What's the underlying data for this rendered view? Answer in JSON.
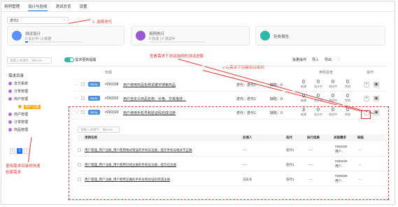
{
  "tabs": [
    "用例管理",
    "设计与验收",
    "测试总览",
    "设置"
  ],
  "iteration_select": "迭代1",
  "anno": {
    "select": "1. 选择迭代",
    "view": "查看需求下测试用例的测试进展",
    "create": "2.在需求下创建测试用例",
    "tree": "使用需求目录树快速",
    "tree2": "检索需求"
  },
  "cards": [
    {
      "title": "测试设计",
      "sub": "0 设计中 | 3 新建",
      "color": "#5b8ff9",
      "progress": 0.05
    },
    {
      "title": "用例执行",
      "sub": "0 完成 | 0 测试中",
      "color": "#9b59d0",
      "progress": 0
    },
    {
      "title": "验收报告",
      "sub": "",
      "color": "#2db7a8",
      "progress": 0
    }
  ],
  "left": {
    "search_placeholder": "请输入关键字，按Enter…",
    "toggle_label": "需求更新提醒",
    "tree_title": "需求目录",
    "tree": [
      "支付系统",
      "订单管理",
      "商户管理",
      "用户注册",
      "商户管理",
      "订单管理",
      "商品管理"
    ],
    "page": "1"
  },
  "toolbar": {
    "batch": "批量操作",
    "import": "导入",
    "export": "导出",
    "more": "⋮"
  },
  "table": {
    "col_title": "标题",
    "col_progress": "用例进度",
    "col_ops": "操作"
  },
  "rows": [
    {
      "id": "#260338",
      "badge": "Story",
      "title": "用户使用商品名称关键字搜索商品",
      "iter": "迭代：迭代1",
      "defect": "缺陷：0",
      "nums": [
        "0",
        "0",
        "0",
        "0"
      ]
    },
    {
      "id": "#260332",
      "badge": "Story",
      "title": "用户自定义商品名称、价格、交易描述…",
      "iter": "迭代：迭代1",
      "defect": "缺陷：0",
      "nums": [
        "0",
        "0",
        "0",
        "0"
      ]
    },
    {
      "id": "#260329",
      "badge": "Story",
      "title": "用户使用手机号和验证码完成注册",
      "iter": "迭代：迭代1",
      "defect": "缺陷：0",
      "nums": [
        "3",
        "0",
        "0",
        "0"
      ]
    }
  ],
  "num_labels": [
    "新建",
    "设计中",
    "测试中",
    "完成"
  ],
  "sub": {
    "search_placeholder": "请输入关键字，按Enter…",
    "headers": [
      "用例名称",
      "处理人",
      "迭代",
      "执行结果",
      "关联需求",
      "缺陷"
    ],
    "rows": [
      {
        "name": "用户管理_用户注册_用户使用格式错误的手机号注册，提示手机号格式不正确",
        "owner": "----",
        "iter": "迭代1",
        "result": "----",
        "req": "#260329",
        "req2": "用户…",
        "bug": "--"
      },
      {
        "name": "用户管理_用户注册_用户使用已经注册的手机号注册，提示已注册",
        "owner": "----",
        "iter": "迭代1",
        "result": "----",
        "req": "#260329",
        "req2": "用户…",
        "bug": "--"
      },
      {
        "name": "用户管理_用户注册_用户使用正确的手机号和验证码完成注册",
        "owner": "马东东",
        "iter": "迭代1",
        "result": "----",
        "req": "#260329",
        "req2": "用户…",
        "bug": "--"
      }
    ]
  }
}
